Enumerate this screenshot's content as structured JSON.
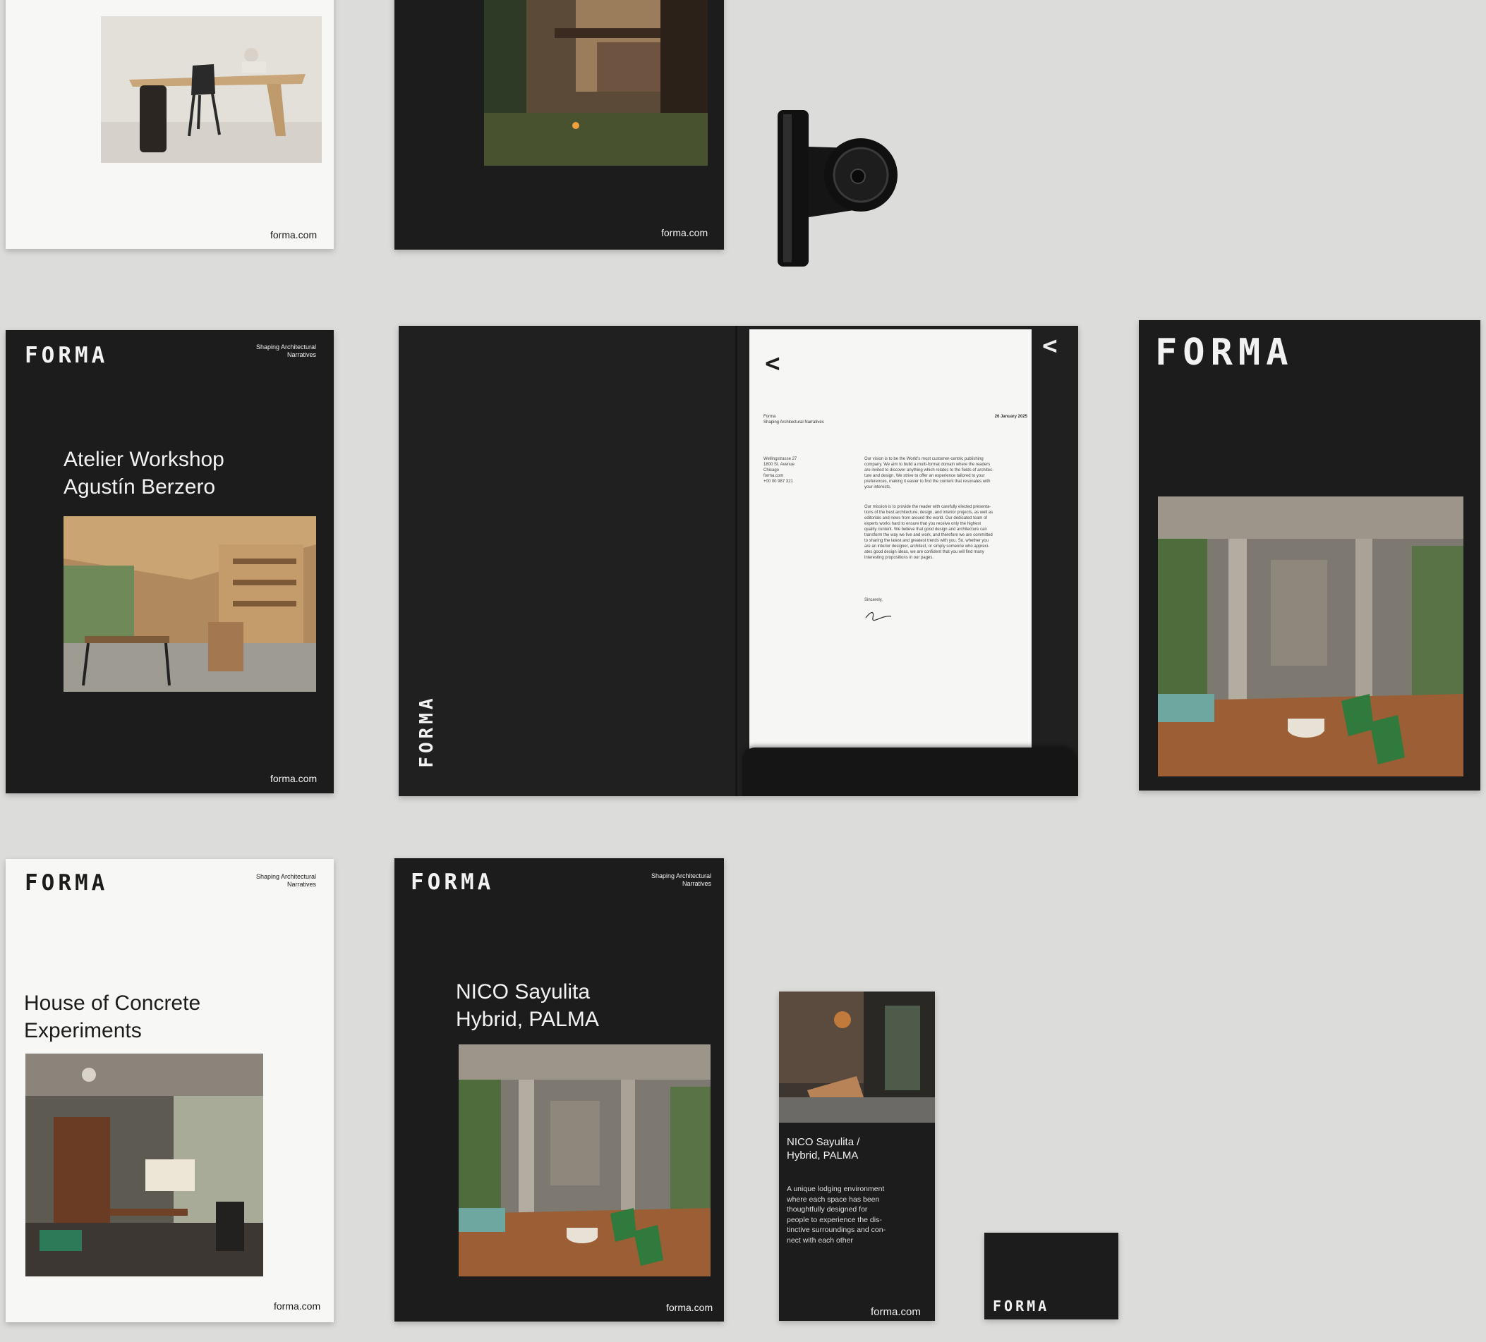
{
  "brand": {
    "logo": "FORMA",
    "url": "forma.com",
    "tagline_line1": "Shaping Architectural",
    "tagline_line2": "Narratives"
  },
  "cards": {
    "atelier": {
      "title_line1": "Atelier Workshop",
      "title_line2": "Agustín Berzero"
    },
    "concrete": {
      "title_line1": "House of Concrete",
      "title_line2": "Experiments"
    },
    "nico": {
      "title_line1": "NICO Sayulita",
      "title_line2": "Hybrid, PALMA"
    },
    "bookmark": {
      "title_line1": "NICO Sayulita /",
      "title_line2": "Hybrid, PALMA",
      "body": [
        "A unique lodging environment",
        "where each space has been",
        "thoughtfully designed for",
        "people to experience the dis-",
        "tinctive surroundings and con-",
        "nect with each other"
      ]
    }
  },
  "letter": {
    "sender_line1": "Forma",
    "sender_line2": "Shaping Architectural Narratives",
    "date": "26 January 2025",
    "address": [
      "Wellingstrasse 27",
      "1800 St. Avenue",
      "Chicago",
      "forma.com",
      "+00 00 987 321"
    ],
    "para1": [
      "Our vision is to be the World's most customer-centric publishing",
      "company. We aim to build a multi-format domain where the readers",
      "are invited to discover anything which relates to the fields of architec-",
      "ture and design. We strive to offer an experience tailored to your",
      "preferences, making it easier to find the content that resonates with",
      "your interests."
    ],
    "para2": [
      "Our mission is to provide the reader with carefully elected presenta-",
      "tions of the best architecture, design, and interior projects, as well as",
      "editorials and news from around the world. Our dedicated team of",
      "experts works hard to ensure that you receive only the highest",
      "quality content. We believe that good design and architecture can",
      "transform the way we live and work, and therefore we are committed",
      "to sharing the latest and greatest trends with you. So, whether you",
      "are an interior designer, architect, or simply someone who appreci-",
      "ates good design ideas, we are confident that you will find many",
      "interesting propositions in our pages."
    ],
    "closing": "Sincerely,"
  },
  "colors": {
    "background": "#dcdcda",
    "dark": "#1c1c1c",
    "light": "#f7f7f5"
  }
}
